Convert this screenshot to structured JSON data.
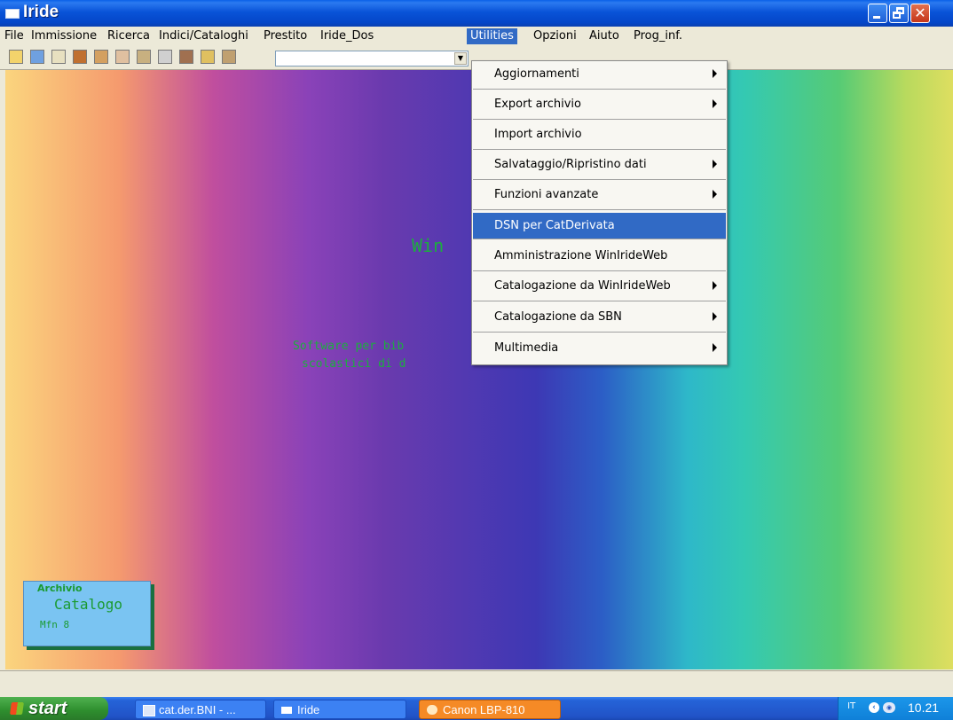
{
  "window": {
    "title": "Iride"
  },
  "menubar": {
    "items": [
      "File",
      "Immissione",
      "Ricerca",
      "Indici/Cataloghi",
      "Prestito",
      "Iride_Dos",
      "Utilities",
      "Opzioni",
      "Aiuto",
      "Prog_inf."
    ],
    "active": "Utilities"
  },
  "toolbar": {
    "icons": [
      "open-icon",
      "window-icon",
      "home-icon",
      "library-icon",
      "catalog-icon",
      "edit-icon",
      "books-icon",
      "gear-icon",
      "binoculars-icon",
      "lightning-icon",
      "chart-icon"
    ],
    "combo_value": ""
  },
  "utilities_menu": {
    "items": [
      {
        "label": "Aggiornamenti",
        "submenu": true
      },
      {
        "label": "Export archivio",
        "submenu": true
      },
      {
        "label": "Import archivio",
        "submenu": false
      },
      {
        "label": "Salvataggio/Ripristino dati",
        "submenu": true
      },
      {
        "label": "Funzioni avanzate",
        "submenu": true
      },
      {
        "label": "DSN per CatDerivata",
        "submenu": false,
        "highlighted": true
      },
      {
        "label": "Amministrazione WinIrideWeb",
        "submenu": false
      },
      {
        "label": "Catalogazione da WinIrideWeb",
        "submenu": true
      },
      {
        "label": "Catalogazione da SBN",
        "submenu": true
      },
      {
        "label": "Multimedia",
        "submenu": true
      }
    ]
  },
  "client": {
    "app_title": "Win",
    "subtitle_line1": "Software per bib",
    "subtitle_line2": "scolastici di d"
  },
  "archive": {
    "label": "Archivio",
    "name": "Catalogo",
    "mfn": "Mfn 8"
  },
  "taskbar": {
    "start_label": "start",
    "tasks": [
      "cat.der.BNI - ...",
      "Iride",
      "Canon LBP-810"
    ],
    "tray_lang": "IT",
    "clock": "10.21"
  },
  "colors": {
    "highlight": "#316ac5",
    "titlebar": "#0a5fe8",
    "app_text": "#1cae3e"
  }
}
